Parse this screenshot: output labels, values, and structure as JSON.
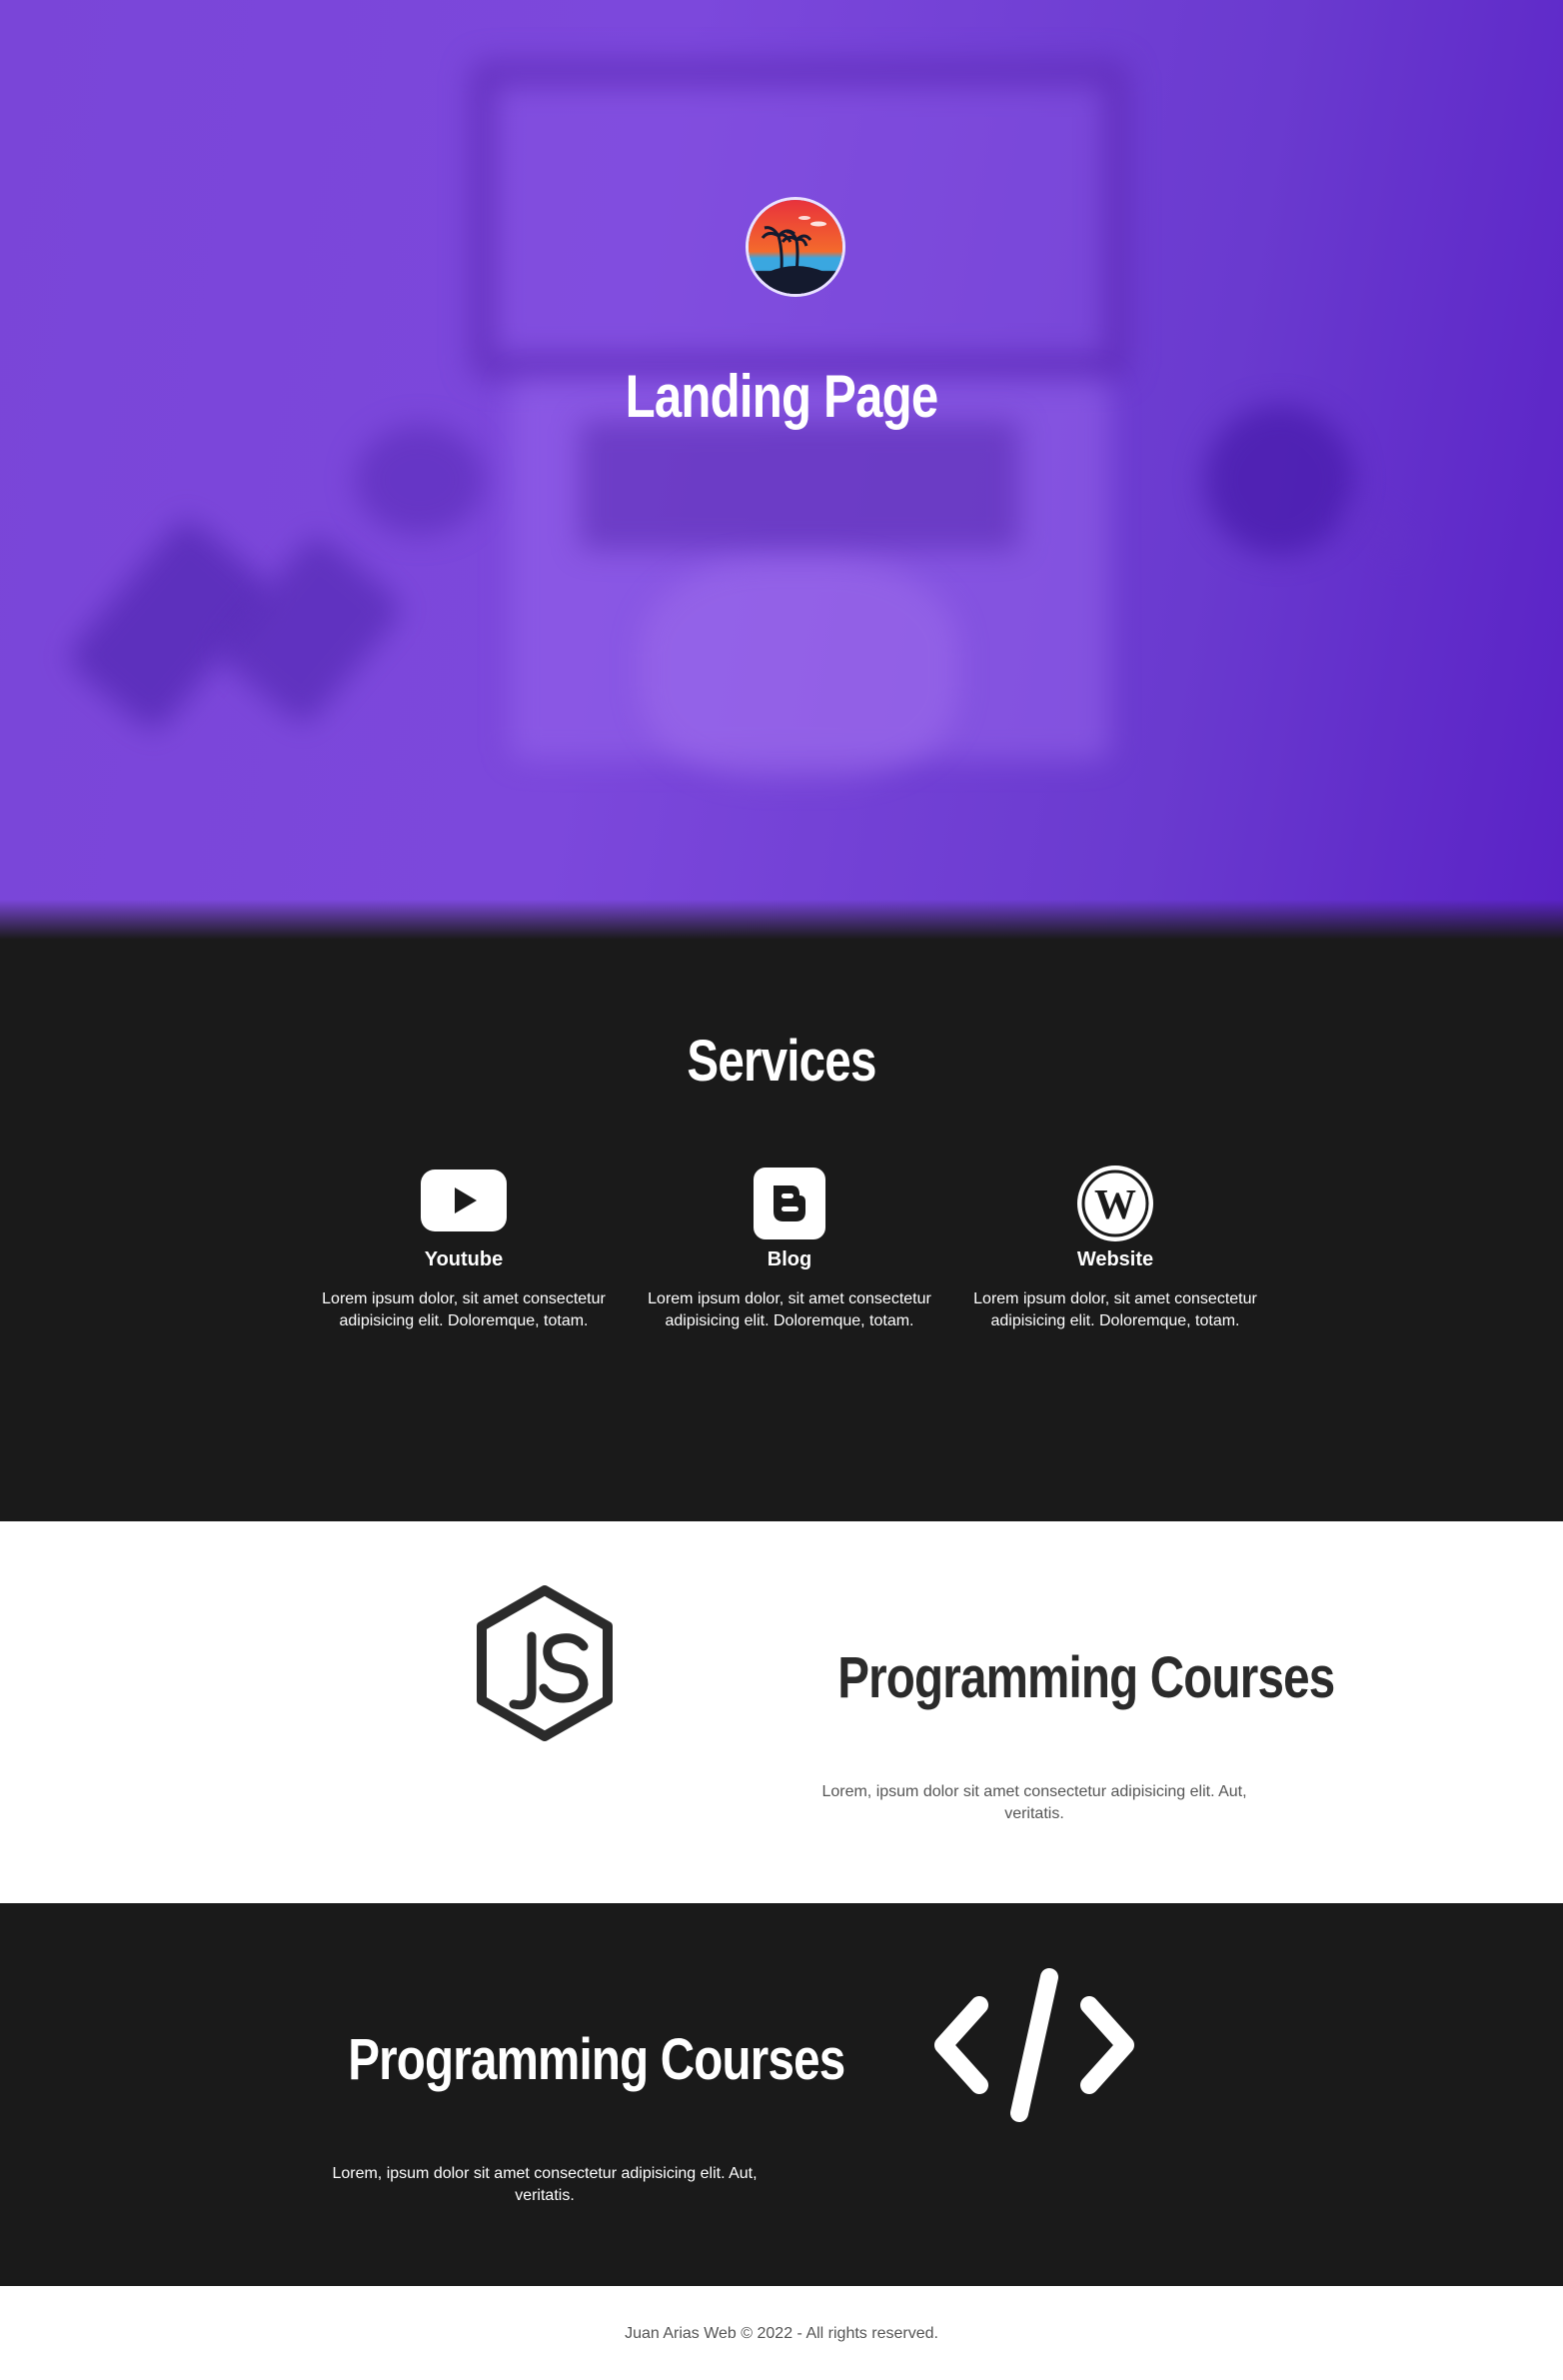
{
  "hero": {
    "title": "Landing Page",
    "logo_icon": "palm-beach-logo-icon",
    "background_color": "#7a45d8"
  },
  "services": {
    "title": "Services",
    "items": [
      {
        "icon": "youtube-icon",
        "name": "Youtube",
        "text": "Lorem ipsum dolor, sit amet consectetur adipisicing elit. Doloremque, totam."
      },
      {
        "icon": "blogger-icon",
        "name": "Blog",
        "text": "Lorem ipsum dolor, sit amet consectetur adipisicing elit. Doloremque, totam."
      },
      {
        "icon": "wordpress-icon",
        "name": "Website",
        "text": "Lorem ipsum dolor, sit amet consectetur adipisicing elit. Doloremque, totam."
      }
    ]
  },
  "courses": [
    {
      "icon": "nodejs-icon",
      "title": "Programming Courses",
      "text": "Lorem, ipsum dolor sit amet consectetur adipisicing elit. Aut, veritatis."
    },
    {
      "icon": "code-icon",
      "title": "Programming Courses",
      "text": "Lorem, ipsum dolor sit amet consectetur adipisicing elit. Aut, veritatis."
    }
  ],
  "footer": {
    "text": "Juan Arias Web © 2022 - All rights reserved."
  },
  "colors": {
    "dark_section": "#1a1a1a",
    "light_section": "#ffffff",
    "hero_purple": "#7a45d8",
    "dark_text": "#2b2b2b"
  }
}
